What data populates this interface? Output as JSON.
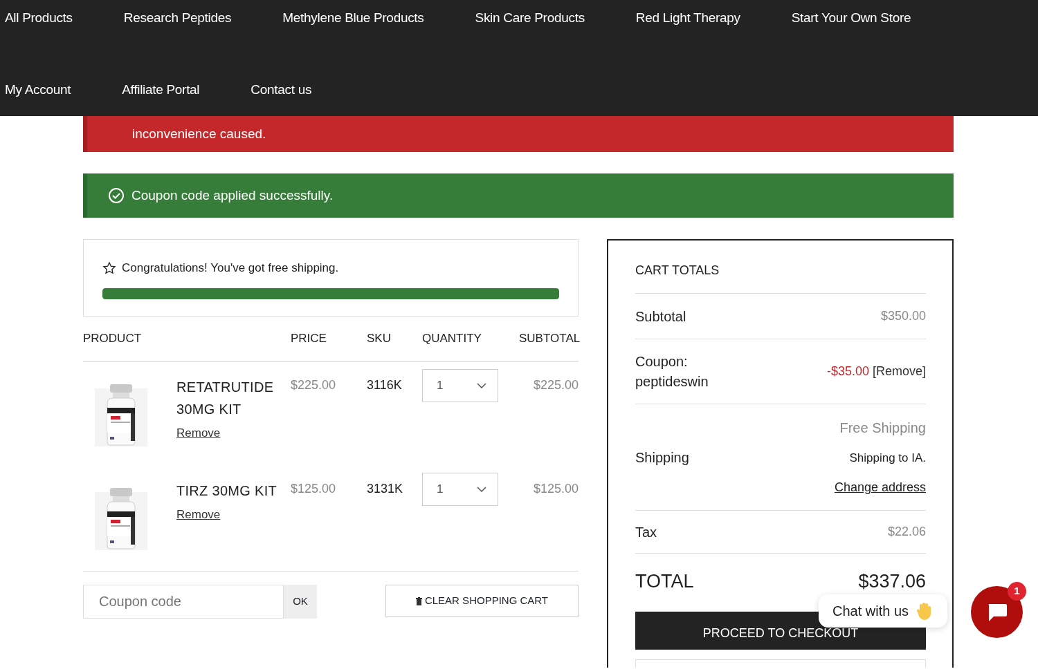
{
  "nav": {
    "rows": [
      [
        "All Products",
        "Research Peptides",
        "Methylene Blue Products",
        "Skin Care Products",
        "Red Light Therapy",
        "Start Your Own Store"
      ],
      [
        "My Account",
        "Affiliate Portal",
        "Contact us"
      ]
    ]
  },
  "notices": [
    {
      "kind": "error",
      "text": "inconvenience caused."
    },
    {
      "kind": "success",
      "text": "Coupon code applied successfully."
    }
  ],
  "shipping_bar": {
    "text": "Congratulations! You've got free shipping.",
    "level": 1
  },
  "table": {
    "columns": [
      "PRODUCT",
      "PRICE",
      "SKU",
      "QUANTITY",
      "SUBTOTAL"
    ],
    "rows": [
      {
        "name": "RETATRUTIDE 30MG KIT",
        "remove": "Remove",
        "price": "$225.00",
        "sku": "3116K",
        "quantity": "1",
        "subtotal": "$225.00"
      },
      {
        "name": "TIRZ 30MG KIT",
        "remove": "Remove",
        "price": "$125.00",
        "sku": "3131K",
        "quantity": "1",
        "subtotal": "$125.00"
      }
    ]
  },
  "coupon": {
    "placeholder": "Coupon code",
    "apply": "OK"
  },
  "clear_cart": "CLEAR SHOPPING CART",
  "totals": {
    "title": "CART TOTALS",
    "subtotal_label": "Subtotal",
    "subtotal": "$350.00",
    "coupon_label": "Coupon: peptideswin",
    "coupon_amount": "-$35.00",
    "coupon_remove": "[Remove]",
    "shipping_label": "Shipping",
    "shipping_method": "Free Shipping",
    "shipping_to": "Shipping to IA.",
    "change_address": "Change address",
    "tax_label": "Tax",
    "tax": "$22.06",
    "total_label": "TOTAL",
    "total": "$337.06",
    "checkout": "PROCEED TO CHECKOUT"
  },
  "chat": {
    "label": "Chat with us",
    "badge": "1"
  }
}
